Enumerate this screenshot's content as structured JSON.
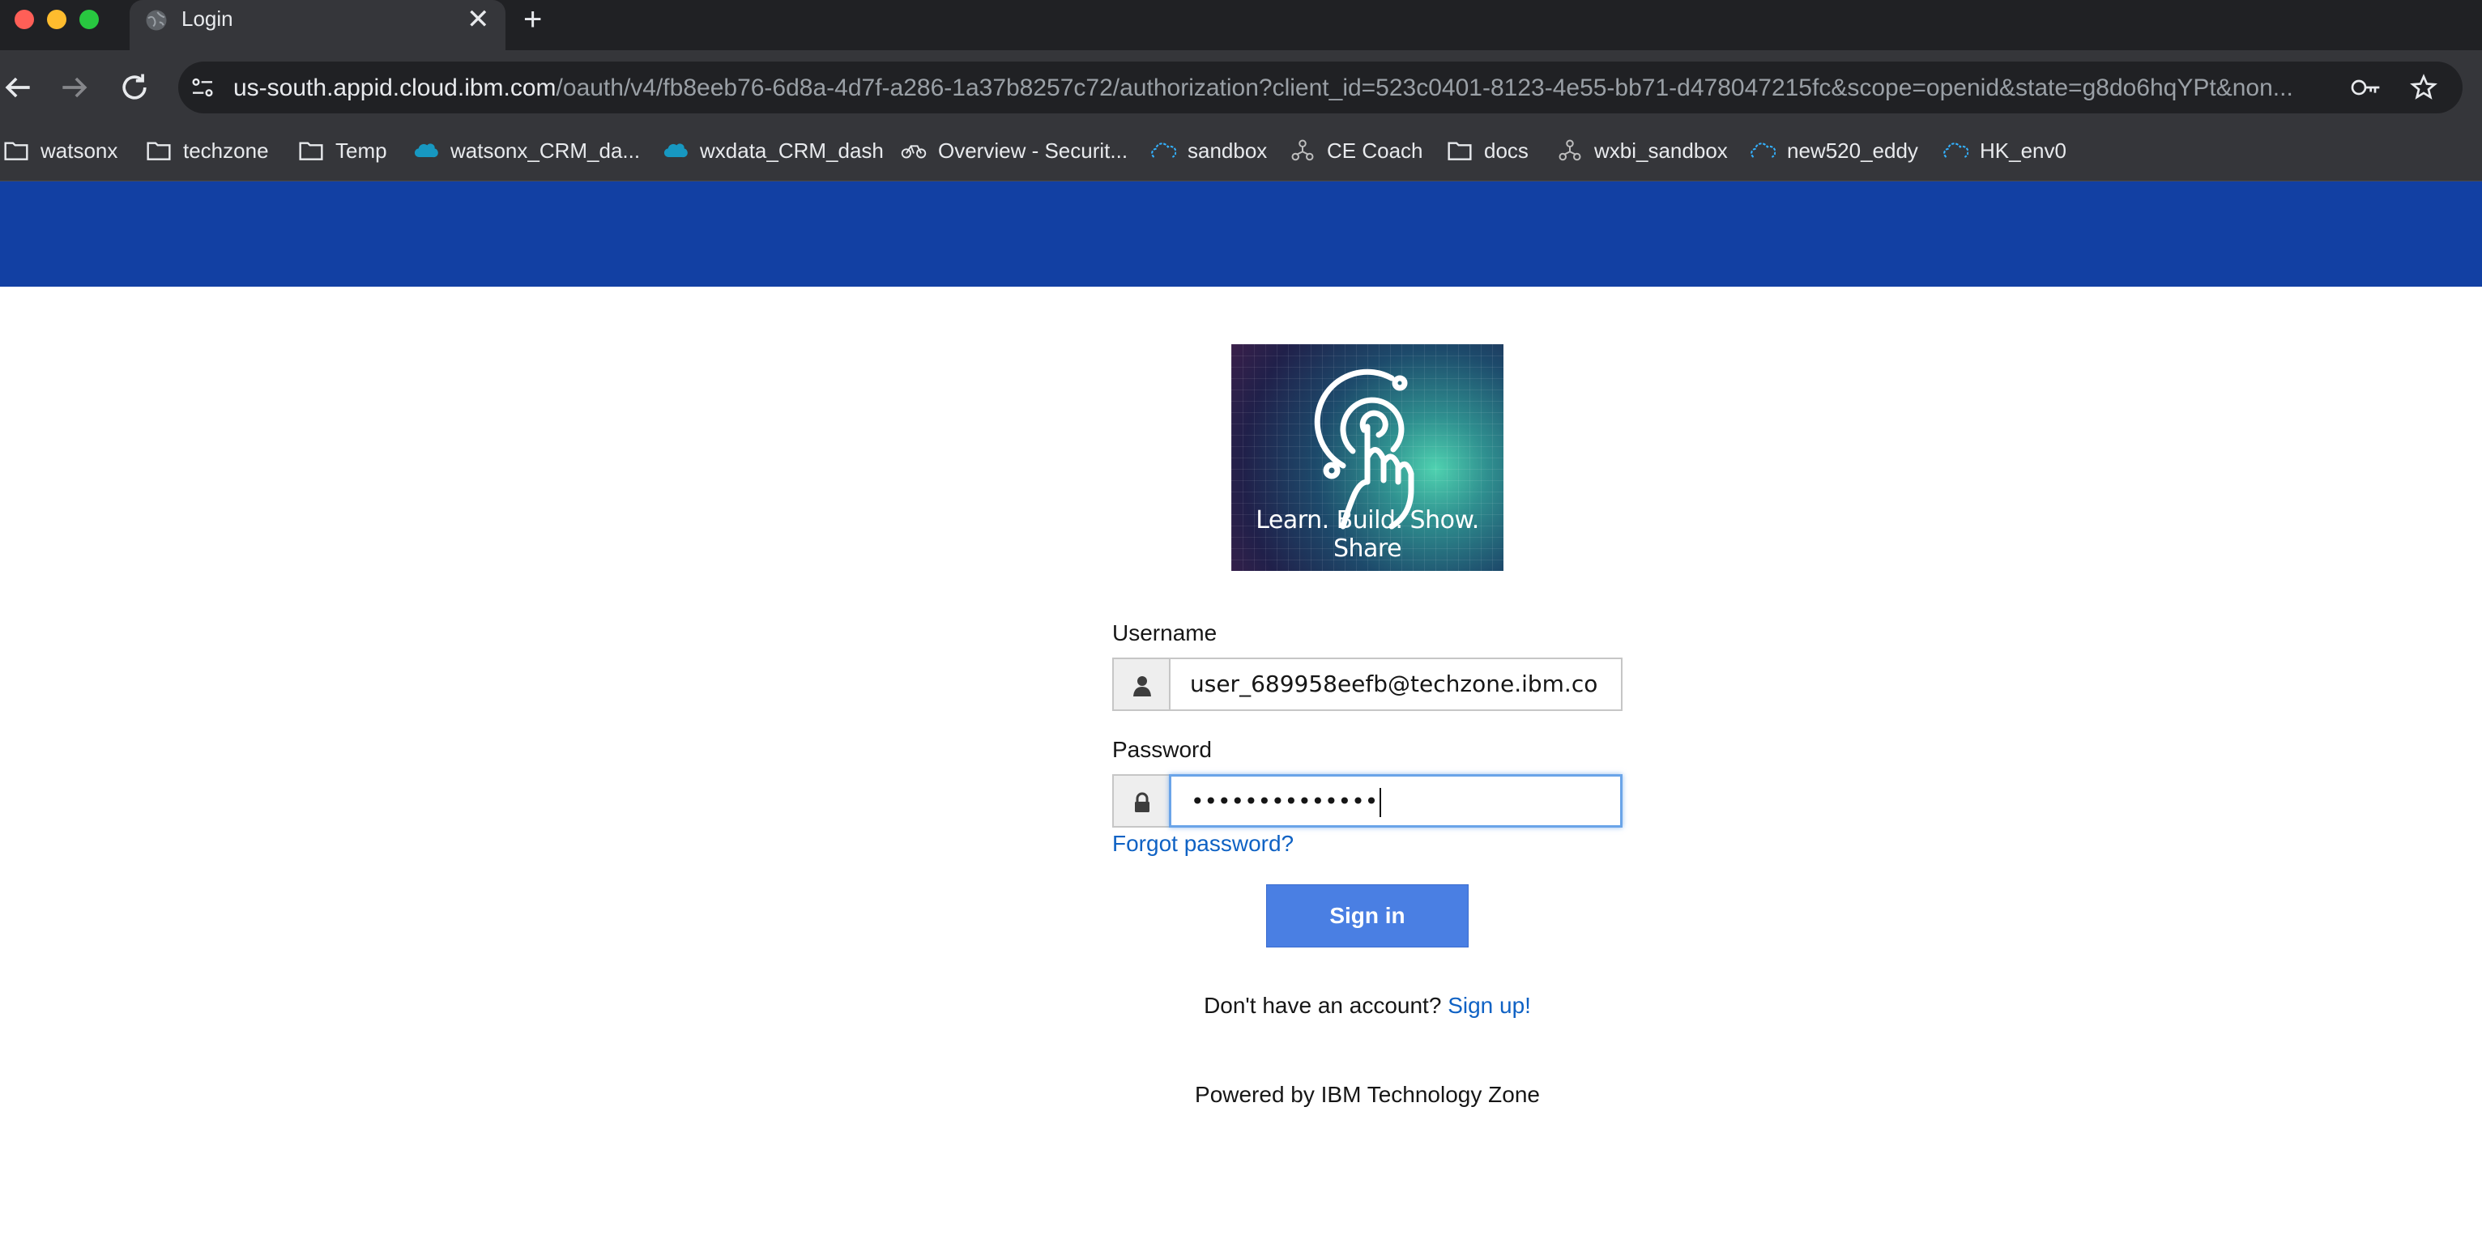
{
  "browser": {
    "tab": {
      "title": "Login",
      "close_glyph": "✕"
    },
    "new_tab_glyph": "+",
    "url": {
      "host": "us-south.appid.cloud.ibm.com",
      "rest": "/oauth/v4/fb8eeb76-6d8a-4d7f-a286-1a37b8257c72/authorization?client_id=523c0401-8123-4e55-bb71-d478047215fc&scope=openid&state=g8do6hqYPt&non..."
    },
    "bookmarks": [
      {
        "label": "watsonx",
        "icon": "folder-icon"
      },
      {
        "label": "techzone",
        "icon": "folder-icon"
      },
      {
        "label": "Temp",
        "icon": "folder-icon"
      },
      {
        "label": "watsonx_CRM_da...",
        "icon": "salesforce-icon"
      },
      {
        "label": "wxdata_CRM_dash",
        "icon": "salesforce-icon"
      },
      {
        "label": "Overview - Securit...",
        "icon": "bike-icon"
      },
      {
        "label": "sandbox",
        "icon": "ibm-cloud-icon"
      },
      {
        "label": "CE Coach",
        "icon": "network-icon"
      },
      {
        "label": "docs",
        "icon": "folder-icon"
      },
      {
        "label": "wxbi_sandbox",
        "icon": "network-icon"
      },
      {
        "label": "new520_eddy",
        "icon": "ibm-cloud-icon"
      },
      {
        "label": "HK_env0",
        "icon": "ibm-cloud-icon"
      }
    ]
  },
  "page": {
    "banner_color": "#1240a3",
    "logo": {
      "tagline": "Learn. Build. Show. Share"
    },
    "username": {
      "label": "Username",
      "value": "user_689958eefb@techzone.ibm.co"
    },
    "password": {
      "label": "Password",
      "masked_value": "••••••••••••••"
    },
    "forgot_password": "Forgot password?",
    "sign_in_button": "Sign in",
    "signup": {
      "prompt": "Don't have an account?",
      "link": "Sign up!"
    },
    "powered_by": "Powered by IBM Technology Zone"
  }
}
